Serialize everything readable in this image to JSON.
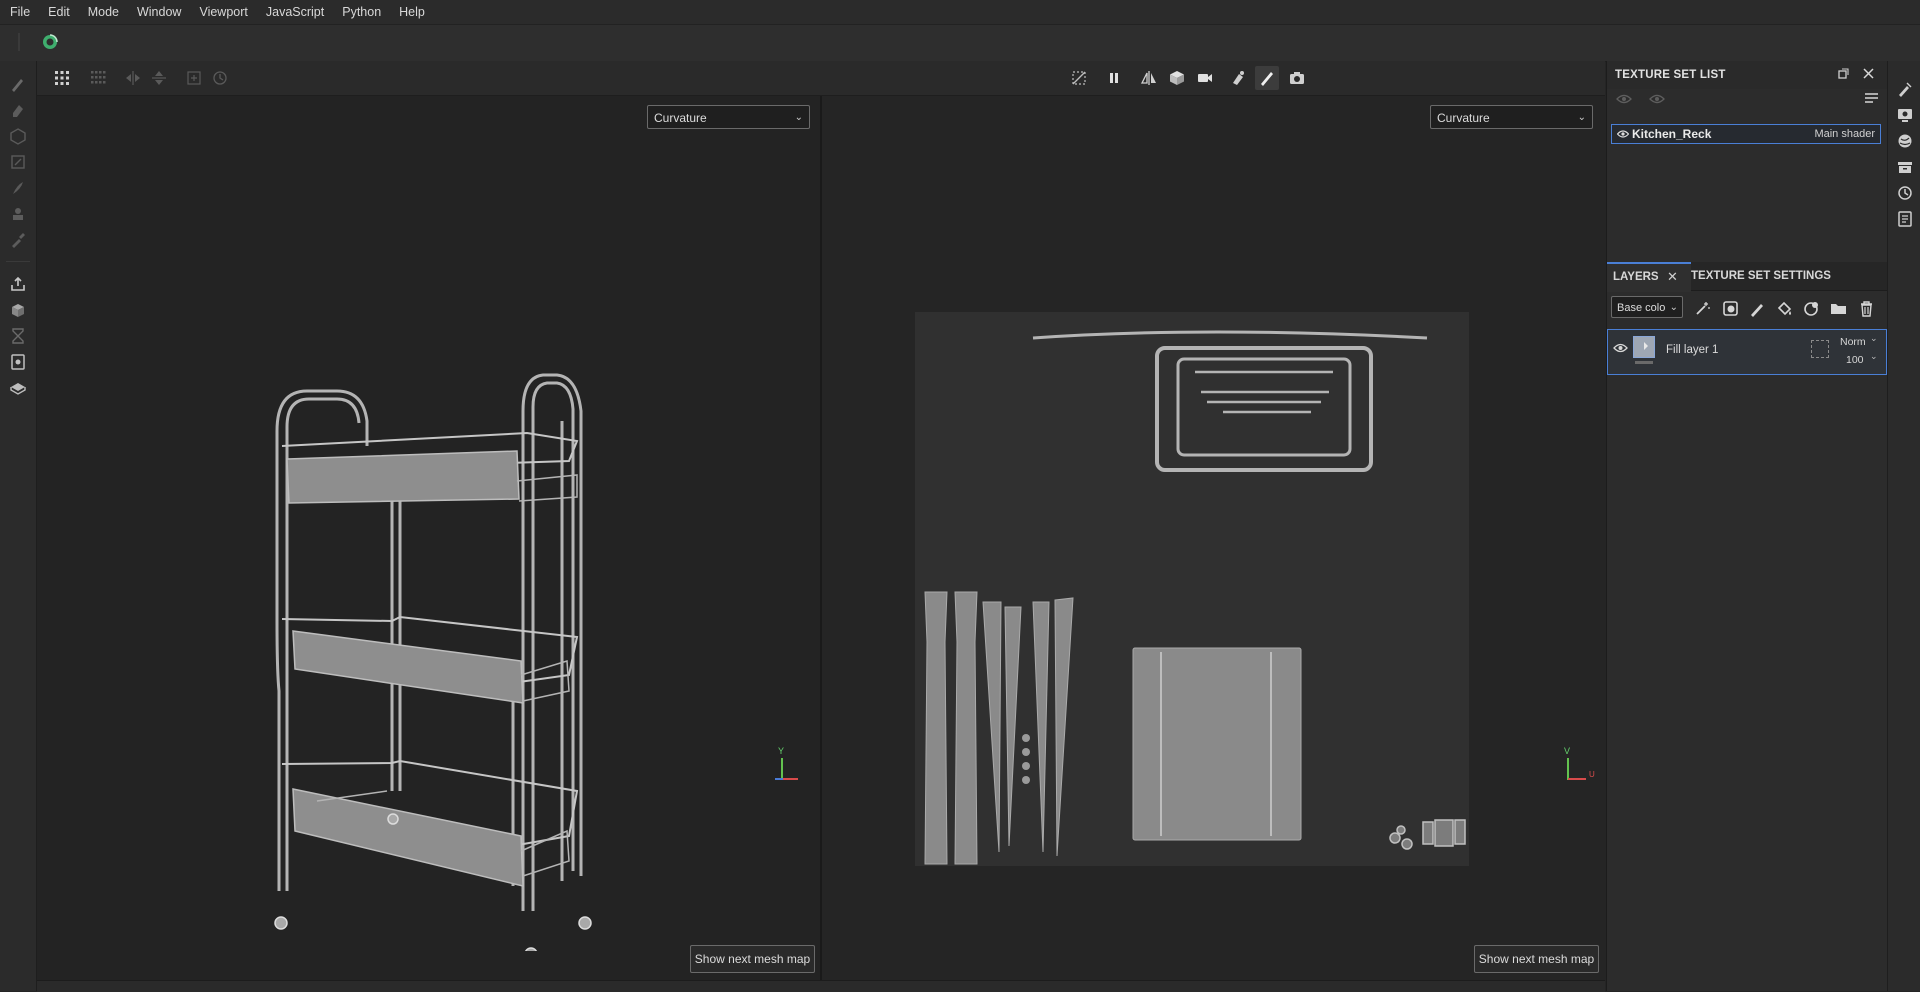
{
  "menu": [
    "File",
    "Edit",
    "Mode",
    "Window",
    "Viewport",
    "JavaScript",
    "Python",
    "Help"
  ],
  "viewport_3d": {
    "channel_select": "Curvature",
    "next_map_button": "Show next mesh map",
    "axis_y": "Y"
  },
  "viewport_2d": {
    "channel_select": "Curvature",
    "next_map_button": "Show next mesh map",
    "axis_v": "V",
    "axis_u": "U"
  },
  "texture_set_list": {
    "title": "TEXTURE SET LIST",
    "items": [
      {
        "name": "Kitchen_Reck",
        "shader": "Main shader"
      }
    ]
  },
  "layers_panel": {
    "tabs": [
      "LAYERS",
      "TEXTURE SET SETTINGS"
    ],
    "channel_select": "Base colo",
    "layers": [
      {
        "name": "Fill layer 1",
        "blend_mode": "Norm",
        "opacity": "100"
      }
    ]
  },
  "colors": {
    "accent": "#4a7fd6",
    "background": "#252525",
    "panel": "#2c2c2c"
  }
}
